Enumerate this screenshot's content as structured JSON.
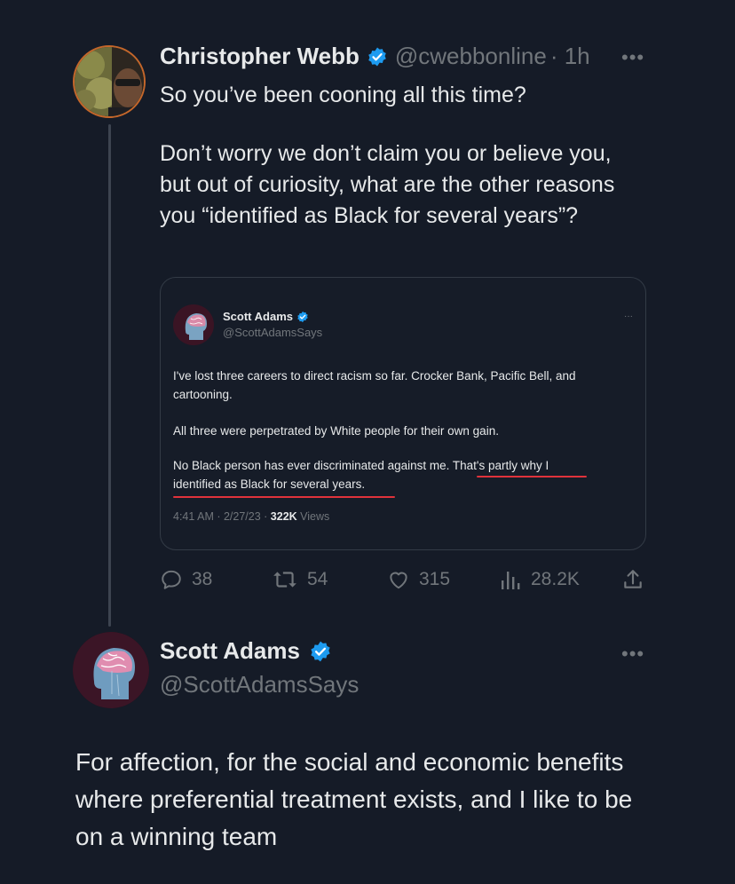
{
  "reply_tweet": {
    "author_name": "Christopher Webb",
    "handle": "@cwebbonline",
    "time": "· 1h",
    "more": "•••",
    "text_line1": "So you’ve been cooning all this time?",
    "text_para2": "Don’t worry we don’t claim you or believe you, but out of curiosity, what are the other reasons you “identified as Black for several years”?",
    "actions": {
      "replies": "38",
      "retweets": "54",
      "likes": "315",
      "views": "28.2K"
    }
  },
  "quoted_tweet": {
    "author_name": "Scott Adams",
    "handle": "@ScottAdamsSays",
    "more": "···",
    "para1": "I've lost three careers to direct racism so far. Crocker Bank, Pacific Bell, and cartooning.",
    "para2": "All three were perpetrated by White people for their own gain.",
    "para3_line1_start": "No Black person has ever discriminated against me. ",
    "para3_line1_highlight": "That's partly why I",
    "para3_line2": "identified as Black for several years.",
    "timestamp": "4:41 AM · 2/27/23 · ",
    "views_count": "322K",
    "views_label": " Views"
  },
  "main_tweet": {
    "author_name": "Scott Adams",
    "handle": "@ScottAdamsSays",
    "more": "•••",
    "text": "For affection, for the social and economic benefits where preferential treatment exists, and I like to be on a winning team"
  },
  "colors": {
    "background": "#151b27",
    "verified": "#1d9bf0",
    "underline": "#e0323b",
    "muted": "#71767b"
  }
}
